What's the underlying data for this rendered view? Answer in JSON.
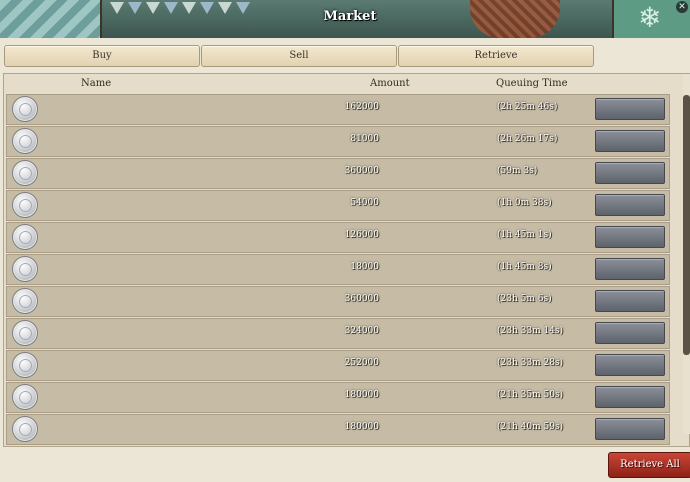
{
  "window": {
    "title": "Market"
  },
  "tabs": [
    {
      "label": "Buy"
    },
    {
      "label": "Sell"
    },
    {
      "label": "Retrieve"
    }
  ],
  "table": {
    "headers": {
      "name": "Name",
      "amount": "Amount",
      "time": "Queuing Time"
    },
    "rows": [
      {
        "icon": "silver-coin-icon",
        "amount": "162000",
        "time": "(2h 25m 46s)"
      },
      {
        "icon": "silver-coin-icon",
        "amount": "81000",
        "time": "(2h 26m 17s)"
      },
      {
        "icon": "silver-coin-icon",
        "amount": "360000",
        "time": "(59m 3s)"
      },
      {
        "icon": "silver-coin-icon",
        "amount": "54000",
        "time": "(1h 0m 38s)"
      },
      {
        "icon": "silver-coin-icon",
        "amount": "126000",
        "time": "(1h 45m 1s)"
      },
      {
        "icon": "silver-coin-icon",
        "amount": "18000",
        "time": "(1h 45m 8s)"
      },
      {
        "icon": "silver-coin-icon",
        "amount": "360000",
        "time": "(23h 5m 6s)"
      },
      {
        "icon": "silver-coin-icon",
        "amount": "324000",
        "time": "(23h 33m 14s)"
      },
      {
        "icon": "silver-coin-icon",
        "amount": "252000",
        "time": "(23h 33m 28s)"
      },
      {
        "icon": "silver-coin-icon",
        "amount": "180000",
        "time": "(21h 35m 50s)"
      },
      {
        "icon": "silver-coin-icon",
        "amount": "180000",
        "time": "(21h 40m 59s)"
      }
    ]
  },
  "footer": {
    "retrieve_all_label": "Retrieve All"
  },
  "colors": {
    "accent_red": "#b23a2c",
    "row_bg": "#c6bca6",
    "row_button": "#6f737c"
  }
}
